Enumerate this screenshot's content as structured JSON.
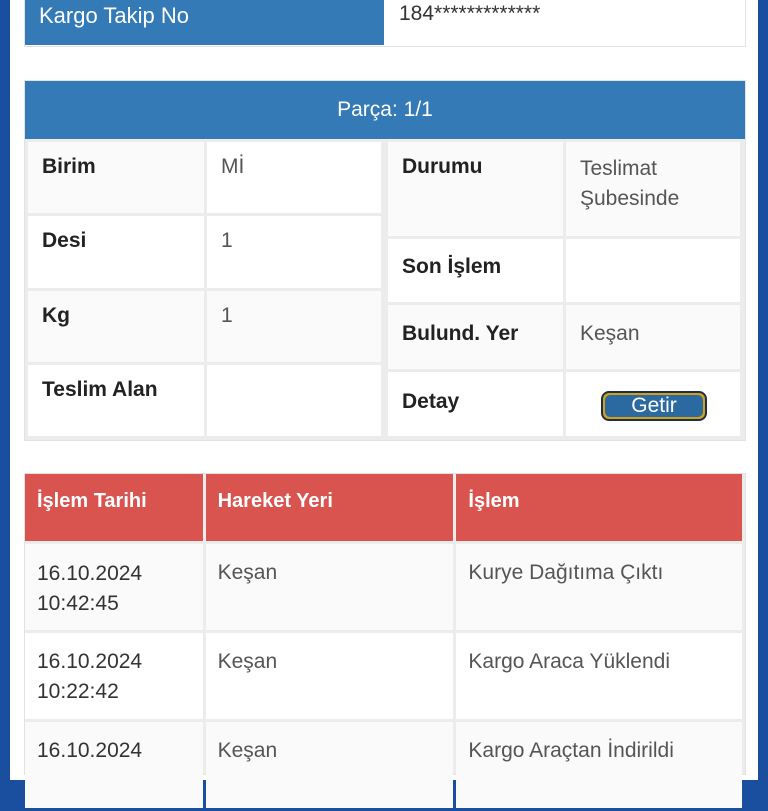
{
  "tracking": {
    "label": "Kargo Takip No",
    "value": "184*************"
  },
  "parts": {
    "header": "Parça: 1/1",
    "left_rows": [
      {
        "key": "Birim",
        "value": "Mİ"
      },
      {
        "key": "Desi",
        "value": "1"
      },
      {
        "key": "Kg",
        "value": "1"
      },
      {
        "key": "Teslim Alan",
        "value": ""
      }
    ],
    "right_rows": [
      {
        "key": "Durumu",
        "value": "Teslimat Şubesinde"
      },
      {
        "key": "Son İşlem",
        "value": ""
      },
      {
        "key": "Bulund. Yer",
        "value": "Keşan"
      },
      {
        "key": "Detay",
        "button": "Getir"
      }
    ]
  },
  "history": {
    "columns": [
      "İşlem Tarihi",
      "Hareket Yeri",
      "İşlem"
    ],
    "rows": [
      {
        "date": "16.10.2024",
        "time": "10:42:45",
        "place": "Keşan",
        "action": "Kurye Dağıtıma Çıktı"
      },
      {
        "date": "16.10.2024",
        "time": "10:22:42",
        "place": "Keşan",
        "action": "Kargo Araca Yüklendi"
      },
      {
        "date": "16.10.2024",
        "time": "",
        "place": "Keşan",
        "action": "Kargo Araçtan İndirildi"
      }
    ]
  },
  "colors": {
    "blue_header": "#337ab7",
    "red_header": "#d9534f",
    "button_gold": "#d4a019",
    "page_bg": "#1a4fa0"
  }
}
